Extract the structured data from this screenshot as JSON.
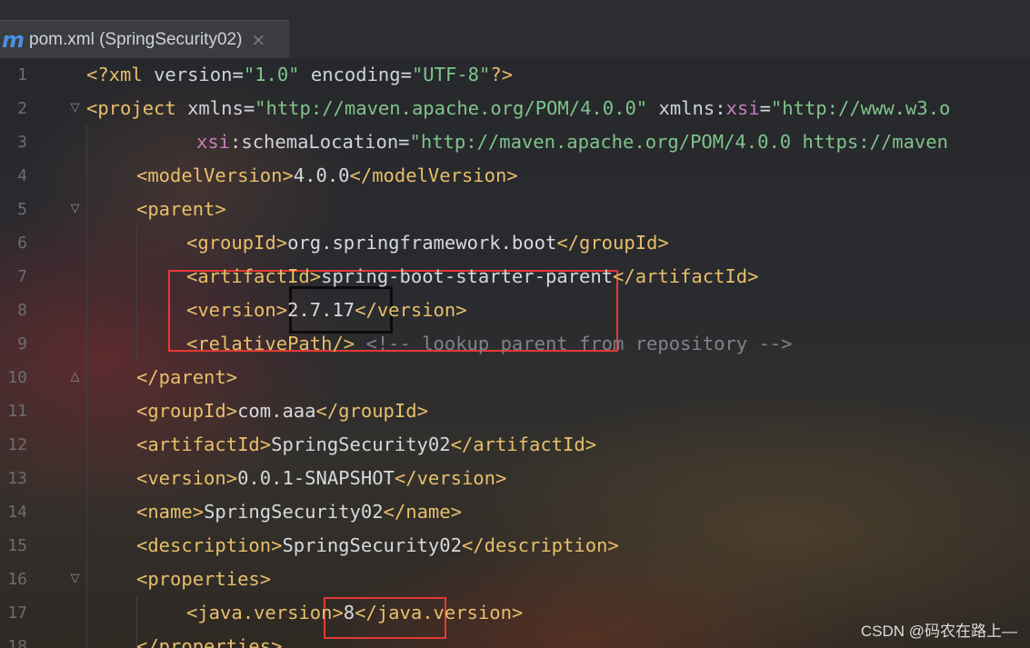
{
  "tab": {
    "icon": "maven-m-icon",
    "icon_glyph": "m",
    "title": "pom.xml (SpringSecurity02)",
    "close_glyph": "×"
  },
  "editor": {
    "lines": [
      {
        "n": "1",
        "fold": "",
        "indent": 0,
        "tokens": [
          {
            "c": "tg",
            "t": "<?xml "
          },
          {
            "c": "at",
            "t": "version"
          },
          {
            "c": "tx",
            "t": "="
          },
          {
            "c": "va",
            "t": "\"1.0\""
          },
          {
            "c": "at",
            "t": " encoding"
          },
          {
            "c": "tx",
            "t": "="
          },
          {
            "c": "va",
            "t": "\"UTF-8\""
          },
          {
            "c": "tg",
            "t": "?>"
          }
        ]
      },
      {
        "n": "2",
        "fold": "open",
        "indent": 0,
        "tokens": [
          {
            "c": "tg",
            "t": "<project "
          },
          {
            "c": "at",
            "t": "xmlns"
          },
          {
            "c": "tx",
            "t": "="
          },
          {
            "c": "va",
            "t": "\"http://maven.apache.org/POM/4.0.0\""
          },
          {
            "c": "at",
            "t": " xmlns"
          },
          {
            "c": "tx",
            "t": ":"
          },
          {
            "c": "ns",
            "t": "xsi"
          },
          {
            "c": "tx",
            "t": "="
          },
          {
            "c": "va",
            "t": "\"http://www.w3.o"
          }
        ]
      },
      {
        "n": "3",
        "fold": "",
        "indent": 2.2,
        "tokens": [
          {
            "c": "ns",
            "t": "xsi"
          },
          {
            "c": "at",
            "t": ":schemaLocation"
          },
          {
            "c": "tx",
            "t": "="
          },
          {
            "c": "va",
            "t": "\"http://maven.apache.org/POM/4.0.0 https://maven"
          }
        ]
      },
      {
        "n": "4",
        "fold": "",
        "indent": 1,
        "tokens": [
          {
            "c": "tg",
            "t": "<modelVersion>"
          },
          {
            "c": "tx",
            "t": "4.0.0"
          },
          {
            "c": "tg",
            "t": "</modelVersion>"
          }
        ]
      },
      {
        "n": "5",
        "fold": "open",
        "indent": 1,
        "tokens": [
          {
            "c": "tg",
            "t": "<parent>"
          }
        ]
      },
      {
        "n": "6",
        "fold": "",
        "indent": 2,
        "tokens": [
          {
            "c": "tg",
            "t": "<groupId>"
          },
          {
            "c": "tx",
            "t": "org.springframework.boot"
          },
          {
            "c": "tg",
            "t": "</groupId>"
          }
        ]
      },
      {
        "n": "7",
        "fold": "",
        "indent": 2,
        "tokens": [
          {
            "c": "tg",
            "t": "<artifactId>"
          },
          {
            "c": "tx",
            "t": "spring-boot-starter-parent"
          },
          {
            "c": "tg",
            "t": "</artifactId>"
          }
        ]
      },
      {
        "n": "8",
        "fold": "",
        "indent": 2,
        "tokens": [
          {
            "c": "tg",
            "t": "<version>"
          },
          {
            "c": "tx",
            "t": "2.7.17"
          },
          {
            "c": "tg",
            "t": "</version>"
          }
        ]
      },
      {
        "n": "9",
        "fold": "",
        "indent": 2,
        "tokens": [
          {
            "c": "tg",
            "t": "<relativePath/>"
          },
          {
            "c": "cm",
            "t": " <!-- lookup parent from repository -->"
          }
        ]
      },
      {
        "n": "10",
        "fold": "close",
        "indent": 1,
        "tokens": [
          {
            "c": "tg",
            "t": "</parent>"
          }
        ]
      },
      {
        "n": "11",
        "fold": "",
        "indent": 1,
        "tokens": [
          {
            "c": "tg",
            "t": "<groupId>"
          },
          {
            "c": "tx",
            "t": "com.aaa"
          },
          {
            "c": "tg",
            "t": "</groupId>"
          }
        ]
      },
      {
        "n": "12",
        "fold": "",
        "indent": 1,
        "tokens": [
          {
            "c": "tg",
            "t": "<artifactId>"
          },
          {
            "c": "tx",
            "t": "SpringSecurity02"
          },
          {
            "c": "tg",
            "t": "</artifactId>"
          }
        ]
      },
      {
        "n": "13",
        "fold": "",
        "indent": 1,
        "tokens": [
          {
            "c": "tg",
            "t": "<version>"
          },
          {
            "c": "tx",
            "t": "0.0.1-SNAPSHOT"
          },
          {
            "c": "tg",
            "t": "</version>"
          }
        ]
      },
      {
        "n": "14",
        "fold": "",
        "indent": 1,
        "tokens": [
          {
            "c": "tg",
            "t": "<name>"
          },
          {
            "c": "tx",
            "t": "SpringSecurity02"
          },
          {
            "c": "tg",
            "t": "</name>"
          }
        ]
      },
      {
        "n": "15",
        "fold": "",
        "indent": 1,
        "tokens": [
          {
            "c": "tg",
            "t": "<description>"
          },
          {
            "c": "tx",
            "t": "SpringSecurity02"
          },
          {
            "c": "tg",
            "t": "</description>"
          }
        ]
      },
      {
        "n": "16",
        "fold": "open",
        "indent": 1,
        "tokens": [
          {
            "c": "tg",
            "t": "<properties>"
          }
        ]
      },
      {
        "n": "17",
        "fold": "",
        "indent": 2,
        "tokens": [
          {
            "c": "tg",
            "t": "<java.version>"
          },
          {
            "c": "tx",
            "t": "8"
          },
          {
            "c": "tg",
            "t": "</java.version>"
          }
        ]
      },
      {
        "n": "18",
        "fold": "",
        "indent": 1,
        "tokens": [
          {
            "c": "tg",
            "t": "</properties>"
          }
        ]
      }
    ]
  },
  "highlights": {
    "red_box_colour": "#e53935",
    "black_box_colour": "#0b0b0b"
  },
  "watermark": "CSDN @码农在路上—"
}
